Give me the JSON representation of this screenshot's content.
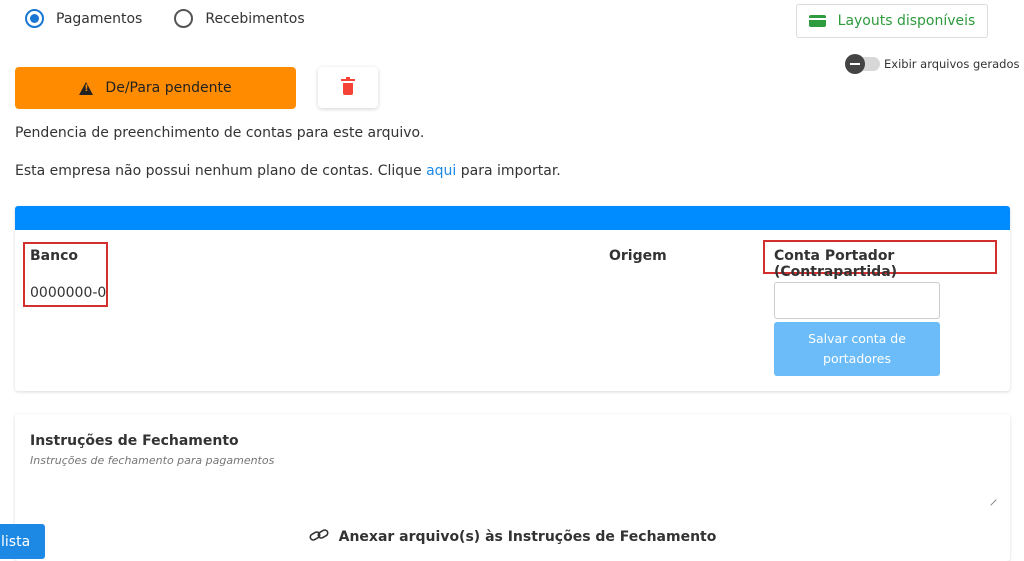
{
  "payment_type": {
    "options": [
      {
        "label": "Pagamentos",
        "selected": true
      },
      {
        "label": "Recebimentos",
        "selected": false
      }
    ]
  },
  "layouts_button": {
    "label": "Layouts disponíveis",
    "icon": "credit-card-icon",
    "color": "#2e9b3f"
  },
  "toggle": {
    "label": "Exibir arquivos gerados",
    "on": false
  },
  "pending_button": {
    "label": "De/Para pendente",
    "icon": "warning-icon",
    "color": "#ff8c00"
  },
  "delete_button": {
    "icon": "trash-icon",
    "color": "#f44336"
  },
  "messages": {
    "pending": "Pendencia de preenchimento de contas para este arquivo.",
    "import_prefix": "Esta empresa não possui nenhum plano de contas. Clique ",
    "import_link": "aqui",
    "import_suffix": " para importar."
  },
  "bank_table": {
    "header_color": "#008cff",
    "columns": {
      "banco": "Banco",
      "origem": "Origem",
      "conta_portador": "Conta Portador (Contrapartida)"
    },
    "rows": [
      {
        "banco": "0000000-0"
      }
    ],
    "input": {
      "value": "",
      "placeholder": ""
    },
    "save_label": "Salvar conta de portadores"
  },
  "instructions": {
    "title": "Instruções de Fechamento",
    "placeholder": "Instruções de fechamento para pagamentos",
    "attach_label": "Anexar arquivo(s) às Instruções de Fechamento",
    "attach_icon": "link-icon"
  },
  "list_button": {
    "label": "lista"
  }
}
